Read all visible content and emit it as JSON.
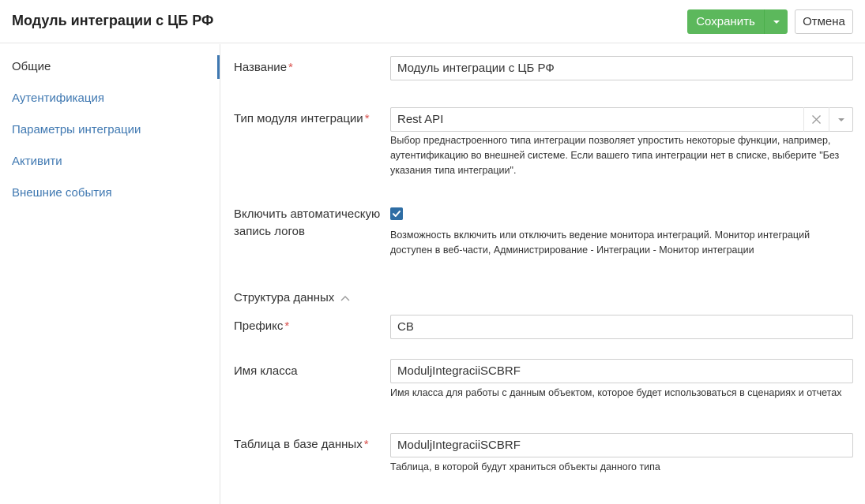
{
  "header": {
    "title": "Модуль интеграции с ЦБ РФ",
    "save_label": "Сохранить",
    "cancel_label": "Отмена"
  },
  "sidebar": {
    "items": [
      {
        "label": "Общие",
        "active": true
      },
      {
        "label": "Аутентификация",
        "active": false
      },
      {
        "label": "Параметры интеграции",
        "active": false
      },
      {
        "label": "Активити",
        "active": false
      },
      {
        "label": "Внешние события",
        "active": false
      }
    ]
  },
  "form": {
    "name": {
      "label": "Название",
      "required": "*",
      "value": "Модуль интеграции с ЦБ РФ"
    },
    "module_type": {
      "label": "Тип модуля интеграции",
      "required": "*",
      "value": "Rest API",
      "hint": "Выбор преднастроенного типа интеграции позволяет упростить некоторые функции, например, аутентификацию во внешней системе. Если вашего типа интеграции нет в списке, выберите \"Без указания типа интеграции\"."
    },
    "auto_logging": {
      "label": "Включить автоматическую запись логов",
      "checked": true,
      "hint": "Возможность включить или отключить ведение монитора интеграций. Монитор интеграций доступен в веб-части, Администрирование - Интеграции - Монитор интеграции"
    },
    "data_structure": {
      "title": "Структура данных"
    },
    "prefix": {
      "label": "Префикс",
      "required": "*",
      "value": "CB"
    },
    "class_name": {
      "label": "Имя класса",
      "value": "ModuljIntegraciiSCBRF",
      "hint": "Имя класса для работы с данным объектом, которое будет использоваться в сценариях и отчетах"
    },
    "db_table": {
      "label": "Таблица в базе данных",
      "required": "*",
      "value": "ModuljIntegraciiSCBRF",
      "hint": "Таблица, в которой будут храниться объекты данного типа"
    }
  },
  "colors": {
    "accent": "#3f78b1",
    "save_button": "#5cb85c",
    "required": "#d9534f",
    "checkbox": "#2e6da4"
  }
}
